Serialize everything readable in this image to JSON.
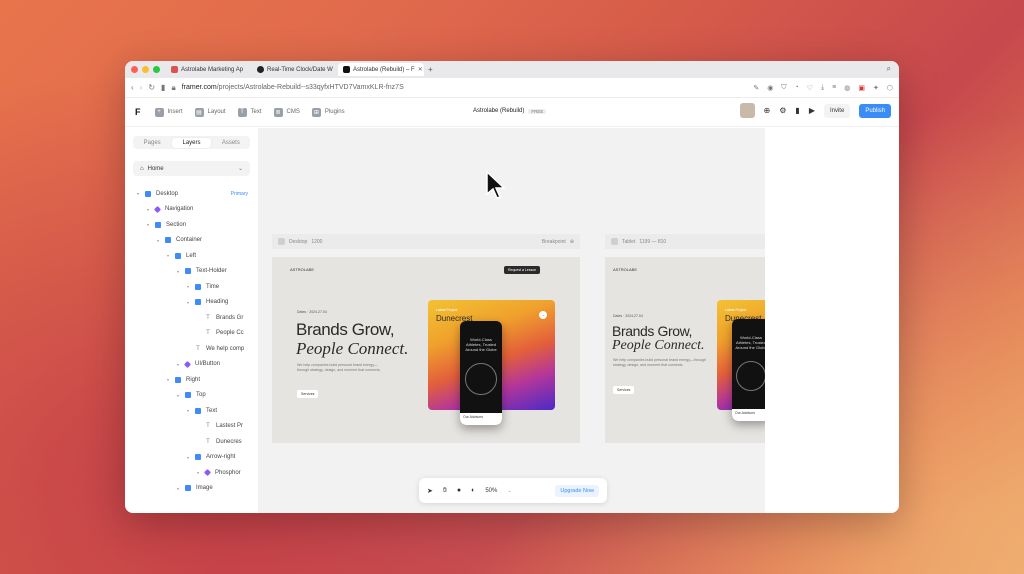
{
  "browser": {
    "tabs": [
      {
        "label": "Astrolabe Marketing Ap",
        "favicon_color": "#d9534f",
        "active": false
      },
      {
        "label": "Real-Time Clock/Date W",
        "favicon_color": "#222222",
        "active": false
      },
      {
        "label": "Astrolabe (Rebuild) – F",
        "favicon_color": "#111111",
        "active": true
      }
    ],
    "new_tab": "+",
    "url_host": "framer.com",
    "url_path": "/projects/Astrolabe-Rebuild--s33qyfxHTVD7VamxKLR-fnz7S"
  },
  "toolbar": {
    "logo": "F",
    "items": [
      {
        "label": "Insert",
        "icon": "plus-icon"
      },
      {
        "label": "Layout",
        "icon": "layout-icon"
      },
      {
        "label": "Text",
        "icon": "text-icon"
      },
      {
        "label": "CMS",
        "icon": "database-icon"
      },
      {
        "label": "Plugins",
        "icon": "grid-icon"
      }
    ],
    "project_title": "Astrolabe (Rebuild)",
    "plan_badge": "FREE",
    "invite": "Invite",
    "publish": "Publish"
  },
  "sidebar": {
    "tabs": [
      "Pages",
      "Layers",
      "Assets"
    ],
    "active_tab": "Layers",
    "page_select": "Home",
    "layers": [
      {
        "label": "Desktop",
        "depth": 0,
        "type": "frame",
        "extra": "Primary"
      },
      {
        "label": "Navigation",
        "depth": 1,
        "type": "comp"
      },
      {
        "label": "Section",
        "depth": 1,
        "type": "frame"
      },
      {
        "label": "Container",
        "depth": 2,
        "type": "frame"
      },
      {
        "label": "Left",
        "depth": 3,
        "type": "frame"
      },
      {
        "label": "Text-Holder",
        "depth": 4,
        "type": "frame"
      },
      {
        "label": "Time",
        "depth": 5,
        "type": "frame"
      },
      {
        "label": "Heading",
        "depth": 5,
        "type": "frame"
      },
      {
        "label": "Brands Gr",
        "depth": 6,
        "type": "text"
      },
      {
        "label": "People Cc",
        "depth": 6,
        "type": "text"
      },
      {
        "label": "We help comp",
        "depth": 5,
        "type": "text"
      },
      {
        "label": "UI/Button",
        "depth": 4,
        "type": "comp"
      },
      {
        "label": "Right",
        "depth": 3,
        "type": "frame"
      },
      {
        "label": "Top",
        "depth": 4,
        "type": "frame"
      },
      {
        "label": "Text",
        "depth": 5,
        "type": "frame"
      },
      {
        "label": "Lastest Pr",
        "depth": 6,
        "type": "text"
      },
      {
        "label": "Dunecres",
        "depth": 6,
        "type": "text"
      },
      {
        "label": "Arrow-right",
        "depth": 5,
        "type": "frame"
      },
      {
        "label": "Phosphor",
        "depth": 6,
        "type": "comp"
      },
      {
        "label": "Image",
        "depth": 4,
        "type": "frame"
      }
    ]
  },
  "canvas": {
    "frames": [
      {
        "label": "Desktop",
        "size": "1200",
        "breakpoint": "Breakpoint"
      },
      {
        "label": "Tablet",
        "size": "1199 — 810"
      }
    ],
    "site": {
      "brand": "ASTROLABE",
      "cta": "Request a Lesson",
      "tag": "Dates · 2024.27.04",
      "headline_1": "Brands Grow,",
      "headline_2": "People Connect.",
      "body": "We help companies build personal brand energy—through strategy, design, and moment that connects.",
      "services_btn": "Services",
      "card_tag": "Latest Project",
      "card_name": "Dunecrest",
      "phone_text": "World-Class Athletes, Trusted Around the Globe",
      "phone_footer": "Our Advisors"
    }
  },
  "bottom_toolbar": {
    "zoom": "50%",
    "upgrade": "Upgrade Now"
  },
  "colors": {
    "accent": "#3a8df5",
    "frame_icon": "#3f8cf7",
    "component_icon": "#8a5cf6"
  }
}
